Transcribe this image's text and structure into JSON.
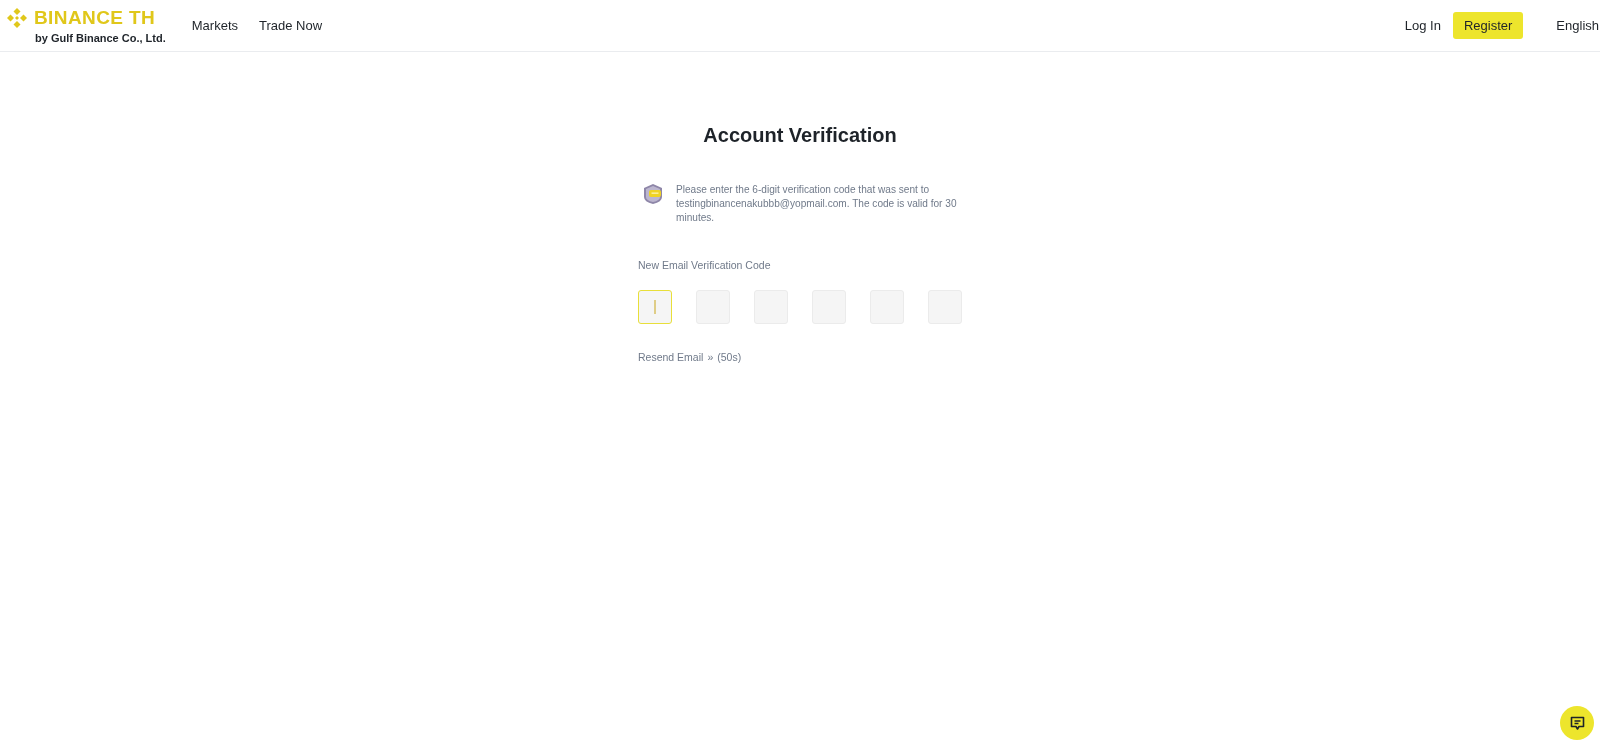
{
  "header": {
    "logo": {
      "name": "BINANCE TH",
      "tagline": "by Gulf Binance Co., Ltd."
    },
    "nav": [
      {
        "label": "Markets"
      },
      {
        "label": "Trade Now"
      }
    ],
    "login": "Log In",
    "register": "Register",
    "language": "English"
  },
  "page": {
    "title": "Account Verification",
    "notice": "Please enter the 6-digit verification code that was sent to testingbinancenakubbb@yopmail.com. The code is valid for 30 minutes.",
    "code_label": "New Email Verification Code",
    "code_inputs": [
      {
        "focused": true
      },
      {
        "focused": false
      },
      {
        "focused": false
      },
      {
        "focused": false
      },
      {
        "focused": false
      },
      {
        "focused": false
      }
    ],
    "resend": {
      "label": "Resend Email",
      "arrow": "»",
      "countdown": "(50s)"
    }
  }
}
